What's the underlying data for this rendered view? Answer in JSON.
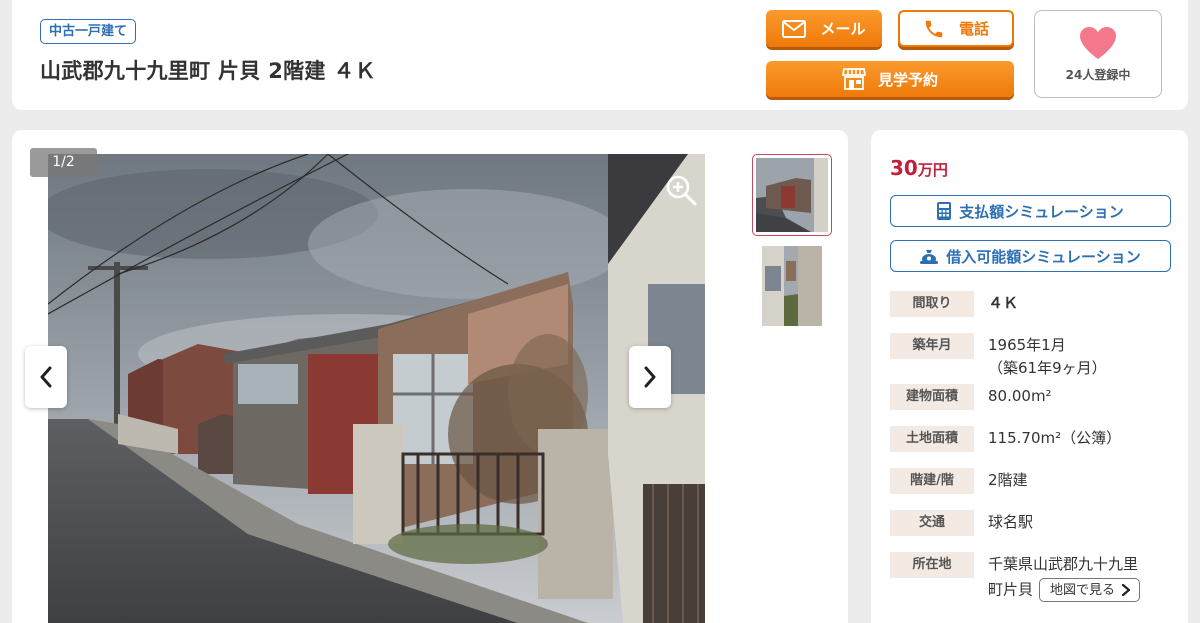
{
  "header": {
    "type_badge": "中古一戸建て",
    "title": "山武郡九十九里町 片貝 2階建 ４Ｋ",
    "mail_label": "メール",
    "tel_label": "電話",
    "visit_label": "見学予約",
    "fav_count": "24人登録中"
  },
  "gallery": {
    "counter": "1/2",
    "icons": [
      "zoom-in-icon",
      "chevron-left-icon",
      "chevron-right-icon"
    ]
  },
  "info": {
    "price_num": "30",
    "price_unit": "万円",
    "sim_payment": "支払額シミュレーション",
    "sim_borrow": "借入可能額シミュレーション",
    "specs": [
      {
        "label": "間取り",
        "value": "４Ｋ"
      },
      {
        "label": "築年月",
        "value": "1965年1月",
        "value2": "（築61年9ヶ月）"
      },
      {
        "label": "建物面積",
        "value": "80.00m²"
      },
      {
        "label": "土地面積",
        "value": "115.70m²（公簿）"
      },
      {
        "label": "階建/階",
        "value": "2階建"
      },
      {
        "label": "交通",
        "value": "球名駅"
      },
      {
        "label": "所在地",
        "value": "千葉県山武郡九十九里",
        "value2": "町片貝"
      }
    ],
    "map_button": "地図で見る"
  },
  "colors": {
    "accent_orange": "#ee7a0a",
    "link_blue": "#2d6fb3",
    "price_red": "#c0203c",
    "heart_pink": "#f3788c",
    "spec_label_bg": "#f3ebe3"
  }
}
